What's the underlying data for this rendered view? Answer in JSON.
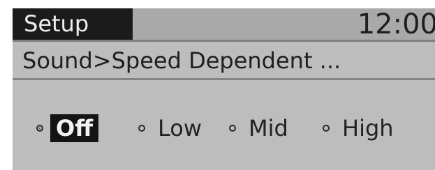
{
  "header": {
    "mode_title": "Setup",
    "clock": "12:00"
  },
  "breadcrumb": {
    "text": "Sound>Speed Dependent ..."
  },
  "speed_dependent_options": [
    {
      "label": "Off",
      "selected": true
    },
    {
      "label": "Low",
      "selected": false
    },
    {
      "label": "Mid",
      "selected": false
    },
    {
      "label": "High",
      "selected": false
    }
  ],
  "colors": {
    "screen_background": "#bdbdbd",
    "header_background": "#a9a9a9",
    "highlight_background": "#141414",
    "text": "#1f1f1f"
  }
}
